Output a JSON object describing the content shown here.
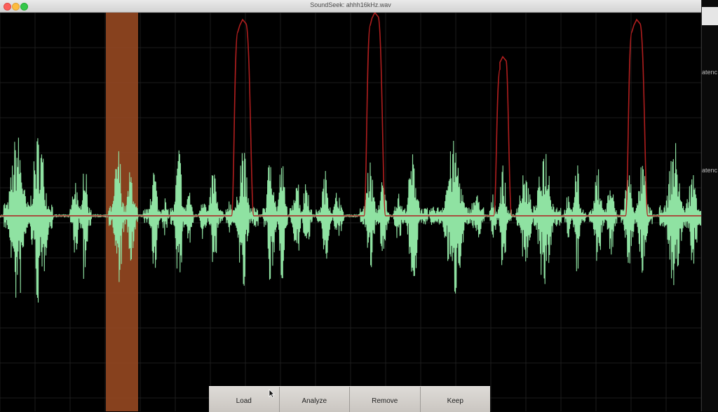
{
  "window": {
    "title": "SoundSeek: ahhh16kHz.wav"
  },
  "toolbar": {
    "buttons": [
      {
        "label": "Load"
      },
      {
        "label": "Analyze"
      },
      {
        "label": "Remove"
      },
      {
        "label": "Keep"
      }
    ]
  },
  "side_panel": {
    "labels": [
      "atenc",
      "atenc"
    ]
  },
  "colors": {
    "background": "#000000",
    "grid": "#1d1d1d",
    "waveform": "#8fe2a2",
    "detection_curve": "#b01e1e",
    "selection": "#9a4a22"
  },
  "icons": {
    "window_controls": [
      "close-icon",
      "minimize-icon",
      "maximize-icon"
    ],
    "pointer": "mouse-pointer-icon"
  }
}
